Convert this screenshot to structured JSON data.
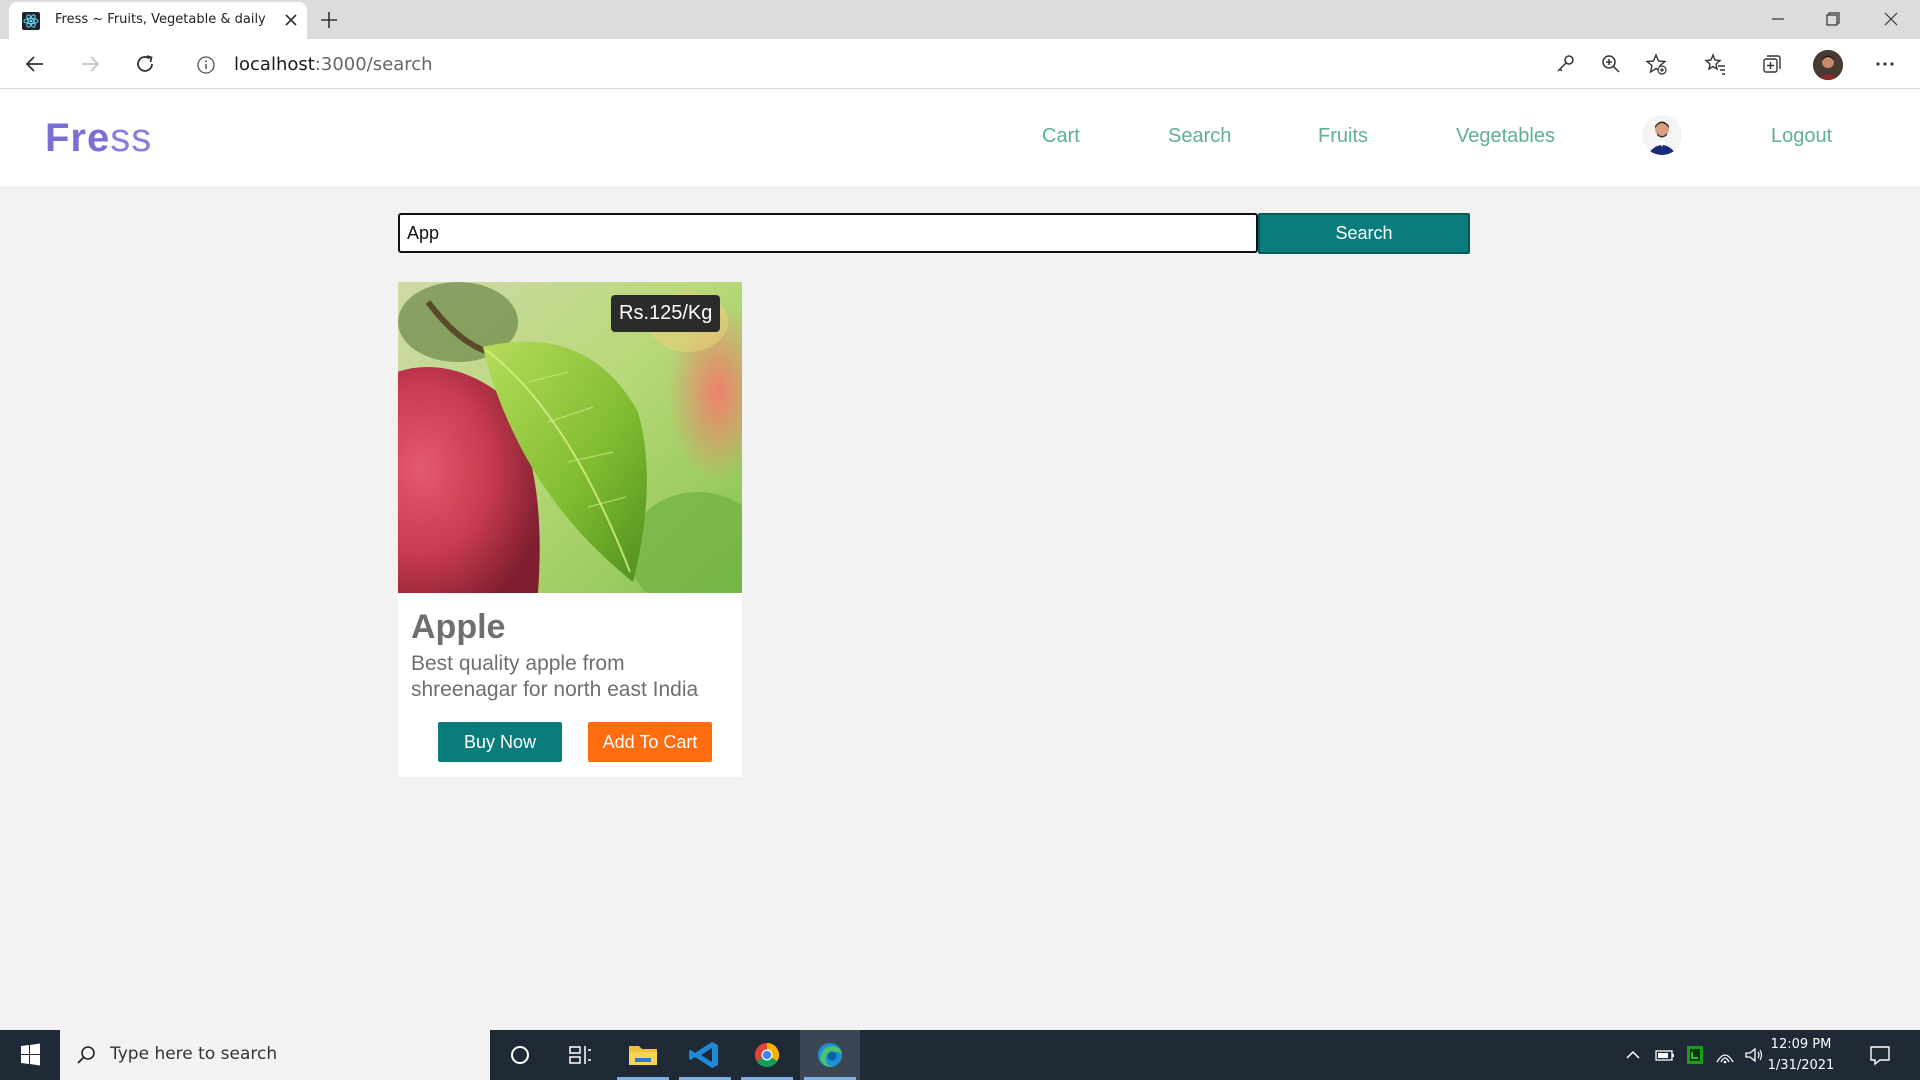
{
  "browser": {
    "tab_title": "Fress ~ Fruits, Vegetable & daily",
    "url_host": "localhost",
    "url_path": ":3000/search"
  },
  "navbar": {
    "logo_bold": "Fre",
    "logo_light": "ss",
    "links": [
      "Cart",
      "Search",
      "Fruits",
      "Vegetables",
      "Logout"
    ]
  },
  "search": {
    "value": "App",
    "button_label": "Search"
  },
  "products": [
    {
      "name": "Apple",
      "price": "Rs.125/Kg",
      "description": "Best quality apple from shreenagar for north east India",
      "buy_label": "Buy Now",
      "cart_label": "Add To Cart"
    }
  ],
  "taskbar": {
    "search_placeholder": "Type here to search",
    "time": "12:09 PM",
    "date": "1/31/2021"
  },
  "colors": {
    "brand": "#7a6fd6",
    "nav_link": "#5fae99",
    "primary": "#0b7c7c",
    "accent": "#ff6d0e"
  }
}
